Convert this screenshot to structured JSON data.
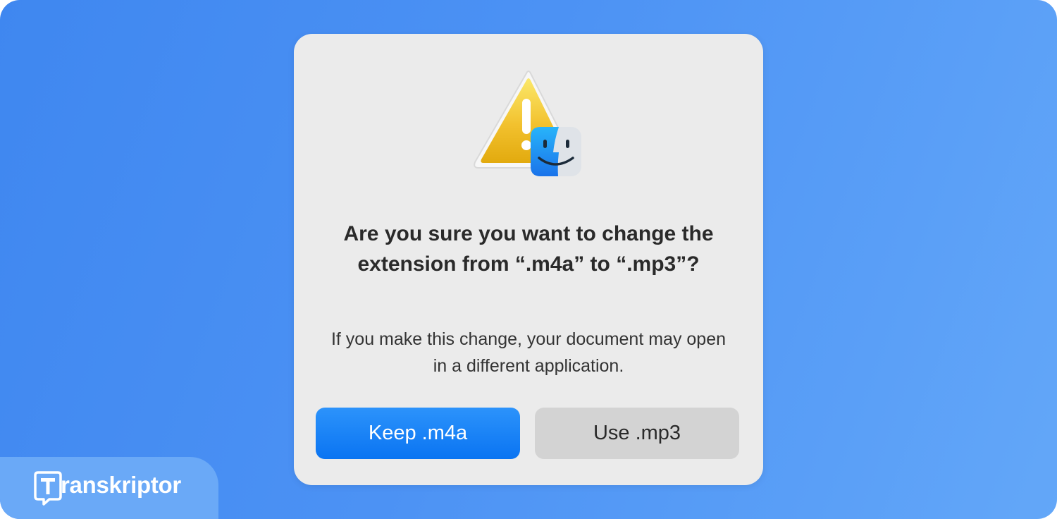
{
  "dialog": {
    "icon": "warning-triangle-with-finder-icon",
    "title": "Are you sure you want to change the extension from “.m4a” to “.mp3”?",
    "message": "If you make this change, your document may open in a different application.",
    "primary_button_label": "Keep .m4a",
    "secondary_button_label": "Use .mp3"
  },
  "branding": {
    "logo_icon": "transkriptor-logo-icon",
    "name": "ranskriptor"
  },
  "colors": {
    "background": "#4c92f4",
    "dialog_background": "#ebebeb",
    "primary_button": "#0a74f2",
    "secondary_button": "#d3d3d3",
    "warning_yellow": "#f2c12e"
  }
}
